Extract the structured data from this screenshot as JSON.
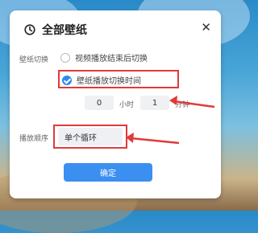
{
  "dialog": {
    "title": "全部壁纸",
    "close_symbol": "✕"
  },
  "wallpaper_switch": {
    "label": "壁纸切换",
    "option_video_end": "视频播放结束后切换",
    "option_time": "壁纸播放切换时间",
    "selected": "option_time"
  },
  "time": {
    "hours_value": "0",
    "hours_unit": "小时",
    "minutes_value": "1",
    "minutes_unit": "分钟"
  },
  "play_order": {
    "label": "播放顺序",
    "value": "单个循环"
  },
  "confirm_label": "确定",
  "colors": {
    "accent": "#3b8ff0",
    "annotation": "#e03a3a"
  }
}
